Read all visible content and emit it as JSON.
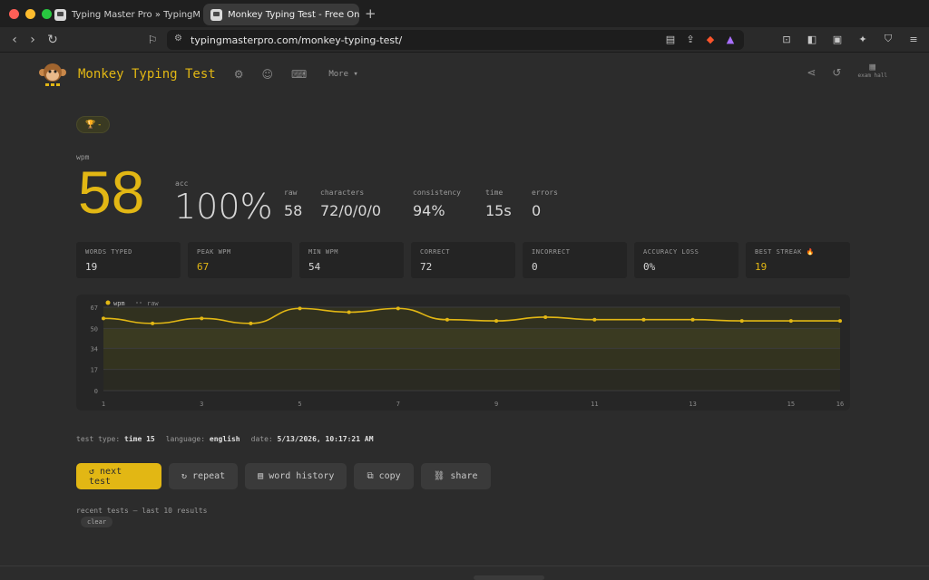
{
  "window": {
    "tabs": [
      {
        "title": "Typing Master Pro » TypingMaster",
        "active": false
      },
      {
        "title": "Monkey Typing Test - Free Onl",
        "active": true
      }
    ],
    "url": "typingmasterpro.com/monkey-typing-test/",
    "brave_badge": "1"
  },
  "header": {
    "site_title": "Monkey Typing Test",
    "more_label": "More ▾",
    "exam_hall_label": "exam hall"
  },
  "result": {
    "badge": "🏆 -",
    "wpm_label": "wpm",
    "wpm": "58",
    "acc_label": "acc",
    "acc": "100%",
    "stats": [
      {
        "label": "raw",
        "value": "58"
      },
      {
        "label": "characters",
        "value": "72/0/0/0"
      },
      {
        "label": "consistency",
        "value": "94%"
      },
      {
        "label": "time",
        "value": "15s"
      },
      {
        "label": "errors",
        "value": "0"
      }
    ],
    "cards": [
      {
        "label": "WORDS TYPED",
        "value": "19",
        "highlight": false
      },
      {
        "label": "PEAK WPM",
        "value": "67",
        "highlight": true
      },
      {
        "label": "MIN WPM",
        "value": "54",
        "highlight": false
      },
      {
        "label": "CORRECT",
        "value": "72",
        "highlight": false
      },
      {
        "label": "INCORRECT",
        "value": "0",
        "highlight": false
      },
      {
        "label": "ACCURACY LOSS",
        "value": "0%",
        "highlight": false
      },
      {
        "label": "BEST STREAK 🔥",
        "value": "19",
        "highlight": true
      }
    ]
  },
  "chart_data": {
    "type": "line",
    "legend": [
      "wpm",
      "raw"
    ],
    "legend_position": "top-left",
    "x": [
      1,
      2,
      3,
      4,
      5,
      6,
      7,
      8,
      9,
      10,
      11,
      12,
      13,
      14,
      15,
      16
    ],
    "x_ticks": [
      "1",
      "3",
      "5",
      "7",
      "9",
      "11",
      "13",
      "15",
      "16"
    ],
    "y_ticks": [
      "0",
      "17",
      "34",
      "50",
      "67"
    ],
    "ylim": [
      0,
      67
    ],
    "series": [
      {
        "name": "wpm",
        "color": "#e2b714",
        "values": [
          58,
          54,
          58,
          54,
          66,
          63,
          66,
          57,
          56,
          59,
          57,
          57,
          57,
          56,
          56,
          56
        ]
      }
    ],
    "grid": true
  },
  "test_info": {
    "type_label": "test type:",
    "type_value": "time 15",
    "language_label": "language:",
    "language_value": "english",
    "date_label": "date:",
    "date_value": "5/13/2026, 10:17:21 AM"
  },
  "actions": {
    "next": "↺ next test",
    "repeat": "↻ repeat",
    "history": "word history",
    "copy": "copy",
    "share": "share"
  },
  "recent": {
    "label": "recent tests — last 10 results",
    "clear": "clear"
  },
  "colors": {
    "accent": "#e2b714",
    "bg": "#2c2c2c"
  }
}
